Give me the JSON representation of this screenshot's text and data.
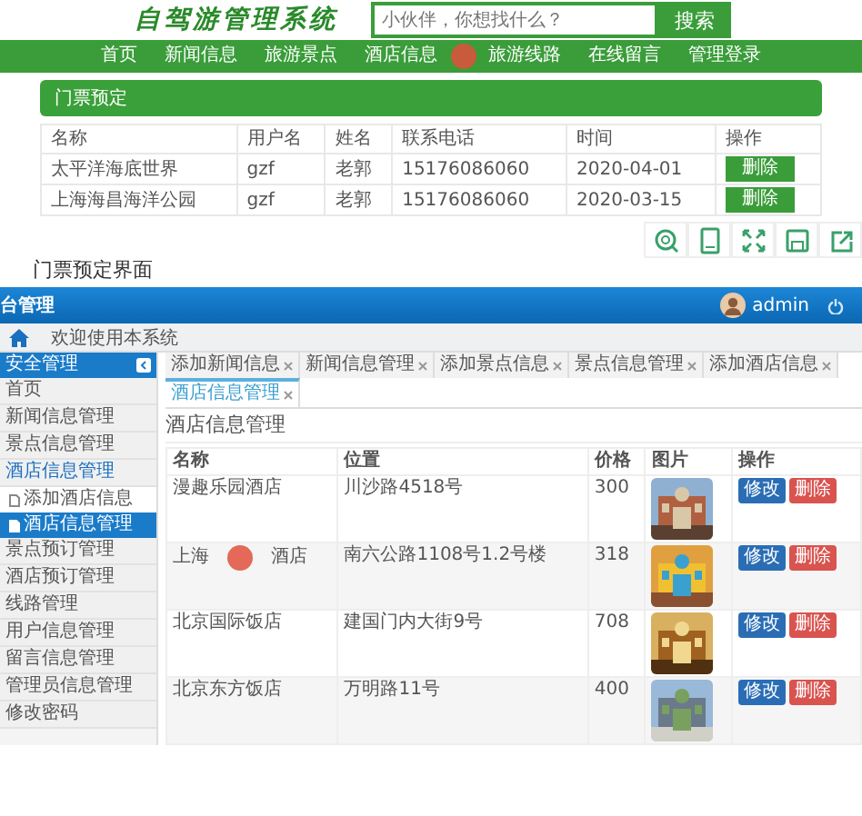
{
  "front_site": {
    "logo": "自驾游管理系统",
    "search": {
      "placeholder": "小伙伴，你想找什么？",
      "button": "搜索"
    },
    "nav": [
      "首页",
      "新闻信息",
      "旅游景点",
      "酒店信息",
      "旅游线路",
      "在线留言",
      "管理登录"
    ],
    "panel_title": "门票预定",
    "table": {
      "columns": [
        "名称",
        "用户名",
        "姓名",
        "联系电话",
        "时间",
        "操作"
      ],
      "rows": [
        {
          "cells": [
            "太平洋海底世界",
            "gzf",
            "老郭",
            "15176086060",
            "2020-04-01"
          ],
          "action": "删除"
        },
        {
          "cells": [
            "上海海昌海洋公园",
            "gzf",
            "老郭",
            "15176086060",
            "2020-03-15"
          ],
          "action": "删除"
        }
      ]
    }
  },
  "caption": "门票预定界面",
  "admin": {
    "title": "台管理",
    "user": "admin",
    "breadcrumb": "欢迎使用本系统",
    "sidebar": {
      "header": "安全管理",
      "items": [
        {
          "label": "首页",
          "expanded": false
        },
        {
          "label": "新闻信息管理",
          "expanded": false
        },
        {
          "label": "景点信息管理",
          "expanded": false
        },
        {
          "label": "酒店信息管理",
          "expanded": true,
          "children": [
            {
              "label": "添加酒店信息",
              "selected": false
            },
            {
              "label": "酒店信息管理",
              "selected": true
            }
          ]
        },
        {
          "label": "景点预订管理",
          "expanded": false
        },
        {
          "label": "酒店预订管理",
          "expanded": false
        },
        {
          "label": "线路管理",
          "expanded": false
        },
        {
          "label": "用户信息管理",
          "expanded": false
        },
        {
          "label": "留言信息管理",
          "expanded": false
        },
        {
          "label": "管理员信息管理",
          "expanded": false
        },
        {
          "label": "修改密码",
          "expanded": false
        }
      ]
    },
    "tabs": [
      {
        "label": "添加新闻信息",
        "selected": false
      },
      {
        "label": "新闻信息管理",
        "selected": false
      },
      {
        "label": "添加景点信息",
        "selected": false
      },
      {
        "label": "景点信息管理",
        "selected": false
      },
      {
        "label": "添加酒店信息",
        "selected": false
      },
      {
        "label": "酒店信息管理",
        "selected": true
      }
    ],
    "page_title": "酒店信息管理",
    "table": {
      "columns": [
        "名称",
        "位置",
        "价格",
        "图片",
        "操作"
      ],
      "rows": [
        {
          "name_parts": [
            "漫趣乐园酒店"
          ],
          "location": "川沙路4518号",
          "price": "300",
          "actions": [
            {
              "label": "修改",
              "kind": "edit"
            },
            {
              "label": "删除",
              "kind": "delete"
            }
          ]
        },
        {
          "name_parts": [
            "上海",
            "酒店"
          ],
          "location": "南六公路1108号1.2号楼",
          "price": "318",
          "actions": [
            {
              "label": "修改",
              "kind": "edit"
            },
            {
              "label": "删除",
              "kind": "delete"
            }
          ]
        },
        {
          "name_parts": [
            "北京国际饭店"
          ],
          "location": "建国门内大街9号",
          "price": "708",
          "actions": [
            {
              "label": "修改",
              "kind": "edit"
            },
            {
              "label": "删除",
              "kind": "delete"
            }
          ]
        },
        {
          "name_parts": [
            "北京东方饭店"
          ],
          "location": "万明路11号",
          "price": "400",
          "actions": [
            {
              "label": "修改",
              "kind": "edit"
            },
            {
              "label": "删除",
              "kind": "delete"
            }
          ]
        }
      ]
    }
  }
}
